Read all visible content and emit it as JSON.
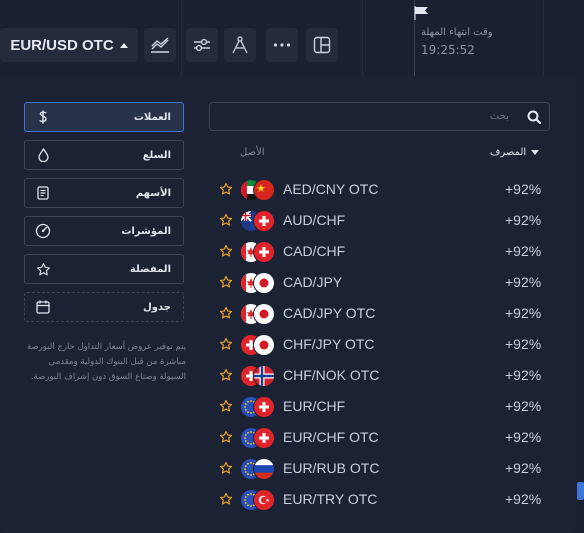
{
  "toolbar": {
    "asset": "EUR/USD OTC",
    "tools": [
      "chart-type-icon",
      "indicators-icon",
      "drawing-icon",
      "more-icon",
      "layout-icon"
    ]
  },
  "deadline": {
    "label": "وقت انتهاء المهلة",
    "time": "19:25:52"
  },
  "categories": [
    {
      "label": "العملات",
      "icon": "dollar-icon",
      "active": true
    },
    {
      "label": "السلع",
      "icon": "drop-icon",
      "active": false
    },
    {
      "label": "الأسهم",
      "icon": "document-icon",
      "active": false
    },
    {
      "label": "المؤشرات",
      "icon": "gauge-icon",
      "active": false
    },
    {
      "label": "المفضلة",
      "icon": "star-icon",
      "active": false
    },
    {
      "label": "جدول",
      "icon": "calendar-icon",
      "active": false
    }
  ],
  "description": "يتم توفير عروض أسعار التداول خارج البورصة مباشرة من قبل البنوك الدولية ومقدمي السيولة وصناع السوق دون إشراف البورصة.",
  "search": {
    "placeholder": "بحث"
  },
  "list_header": {
    "asset": "الأصل",
    "payout": "المصرف"
  },
  "assets": [
    {
      "name": "AED/CNY OTC",
      "payout": "+92%",
      "flags": [
        "ae",
        "cn"
      ]
    },
    {
      "name": "AUD/CHF",
      "payout": "+92%",
      "flags": [
        "au",
        "ch"
      ]
    },
    {
      "name": "CAD/CHF",
      "payout": "+92%",
      "flags": [
        "ca",
        "ch"
      ]
    },
    {
      "name": "CAD/JPY",
      "payout": "+92%",
      "flags": [
        "ca",
        "jp"
      ]
    },
    {
      "name": "CAD/JPY OTC",
      "payout": "+92%",
      "flags": [
        "ca",
        "jp"
      ]
    },
    {
      "name": "CHF/JPY OTC",
      "payout": "+92%",
      "flags": [
        "ch",
        "jp"
      ]
    },
    {
      "name": "CHF/NOK OTC",
      "payout": "+92%",
      "flags": [
        "ch",
        "no"
      ]
    },
    {
      "name": "EUR/CHF",
      "payout": "+92%",
      "flags": [
        "eu",
        "ch"
      ]
    },
    {
      "name": "EUR/CHF OTC",
      "payout": "+92%",
      "flags": [
        "eu",
        "ch"
      ]
    },
    {
      "name": "EUR/RUB OTC",
      "payout": "+92%",
      "flags": [
        "eu",
        "ru"
      ]
    },
    {
      "name": "EUR/TRY OTC",
      "payout": "+92%",
      "flags": [
        "eu",
        "tr"
      ]
    }
  ],
  "colors": {
    "accent": "#3e76d8",
    "star": "#f0a12b",
    "panel": "#1b2233"
  }
}
